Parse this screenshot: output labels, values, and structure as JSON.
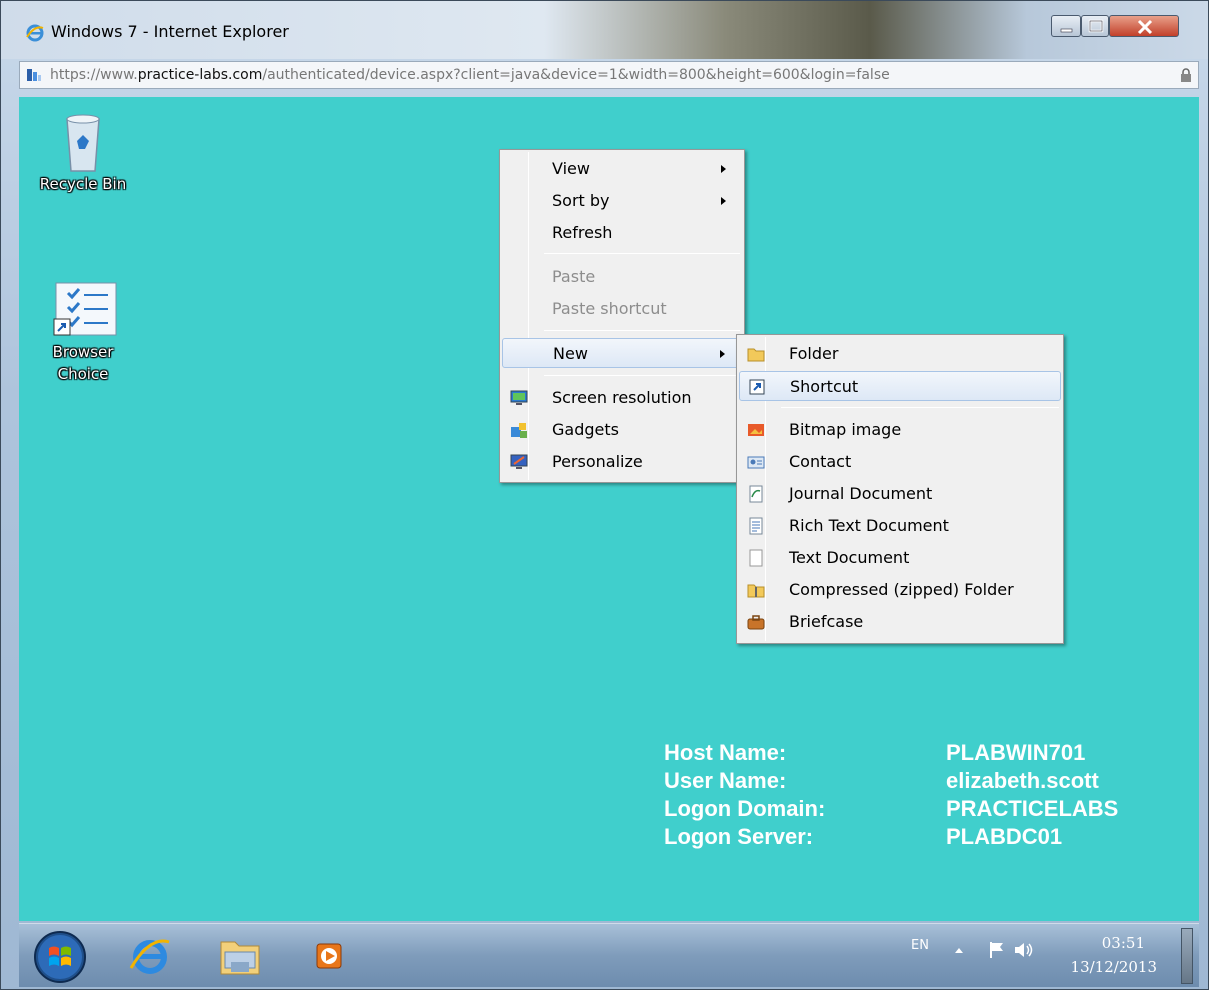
{
  "window": {
    "title": "Windows 7 - Internet Explorer",
    "url_prefix": "https://www.",
    "url_domain": "practice-labs.com",
    "url_path": "/authenticated/device.aspx?client=java&device=1&width=800&height=600&login=false"
  },
  "desktop": {
    "background_color": "#40cfcc",
    "icons": [
      {
        "label": "Recycle Bin",
        "icon": "recycle-bin-icon"
      },
      {
        "label": "Browser Choice",
        "icon": "browser-choice-icon"
      }
    ]
  },
  "context_menu": {
    "items": [
      {
        "label": "View",
        "has_submenu": true,
        "enabled": true
      },
      {
        "label": "Sort by",
        "has_submenu": true,
        "enabled": true
      },
      {
        "label": "Refresh",
        "has_submenu": false,
        "enabled": true
      },
      {
        "label": "Paste",
        "has_submenu": false,
        "enabled": false
      },
      {
        "label": "Paste shortcut",
        "has_submenu": false,
        "enabled": false
      },
      {
        "label": "New",
        "has_submenu": true,
        "enabled": true,
        "highlighted": true
      },
      {
        "label": "Screen resolution",
        "icon": "screen-resolution-icon",
        "enabled": true
      },
      {
        "label": "Gadgets",
        "icon": "gadgets-icon",
        "enabled": true
      },
      {
        "label": "Personalize",
        "icon": "personalize-icon",
        "enabled": true
      }
    ]
  },
  "new_submenu": {
    "items": [
      {
        "label": "Folder",
        "icon": "folder-icon"
      },
      {
        "label": "Shortcut",
        "icon": "shortcut-icon",
        "highlighted": true
      },
      {
        "label": "Bitmap image",
        "icon": "bitmap-icon"
      },
      {
        "label": "Contact",
        "icon": "contact-icon"
      },
      {
        "label": "Journal Document",
        "icon": "journal-icon"
      },
      {
        "label": "Rich Text Document",
        "icon": "rich-text-icon"
      },
      {
        "label": "Text Document",
        "icon": "text-document-icon"
      },
      {
        "label": "Compressed (zipped) Folder",
        "icon": "zip-folder-icon"
      },
      {
        "label": "Briefcase",
        "icon": "briefcase-icon"
      }
    ]
  },
  "system_info": {
    "host_name_label": "Host Name:",
    "host_name": "PLABWIN701",
    "user_name_label": "User Name:",
    "user_name": "elizabeth.scott",
    "logon_domain_label": "Logon Domain:",
    "logon_domain": "PRACTICELABS",
    "logon_server_label": "Logon Server:",
    "logon_server": "PLABDC01"
  },
  "taskbar": {
    "pinned": [
      "internet-explorer-icon",
      "windows-explorer-icon",
      "media-player-icon"
    ],
    "language": "EN",
    "time": "03:51",
    "date": "13/12/2013"
  }
}
